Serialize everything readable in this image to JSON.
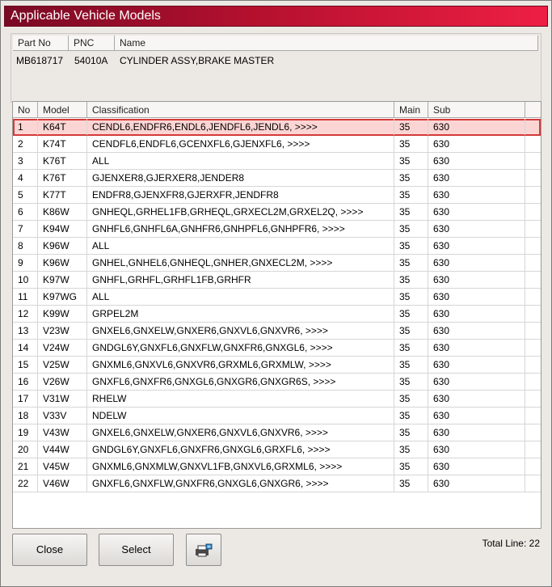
{
  "window": {
    "title": "Applicable Vehicle Models"
  },
  "part": {
    "headers": {
      "part_no": "Part No",
      "pnc": "PNC",
      "name": "Name"
    },
    "values": {
      "part_no": "MB618717",
      "pnc": "54010A",
      "name": "CYLINDER ASSY,BRAKE MASTER"
    }
  },
  "table": {
    "headers": {
      "no": "No",
      "model": "Model",
      "classification": "Classification",
      "main": "Main",
      "sub": "Sub"
    },
    "selected_index": 0,
    "rows": [
      {
        "no": "1",
        "model": "K64T",
        "classification": "CENDL6,ENDFR6,ENDL6,JENDFL6,JENDL6,  >>>>",
        "main": "35",
        "sub": "630"
      },
      {
        "no": "2",
        "model": "K74T",
        "classification": "CENDFL6,ENDFL6,GCENXFL6,GJENXFL6,  >>>>",
        "main": "35",
        "sub": "630"
      },
      {
        "no": "3",
        "model": "K76T",
        "classification": "ALL",
        "main": "35",
        "sub": "630"
      },
      {
        "no": "4",
        "model": "K76T",
        "classification": "GJENXER8,GJERXER8,JENDER8",
        "main": "35",
        "sub": "630"
      },
      {
        "no": "5",
        "model": "K77T",
        "classification": "ENDFR8,GJENXFR8,GJERXFR,JENDFR8",
        "main": "35",
        "sub": "630"
      },
      {
        "no": "6",
        "model": "K86W",
        "classification": "GNHEQL,GRHEL1FB,GRHEQL,GRXECL2M,GRXEL2Q,  >>>>",
        "main": "35",
        "sub": "630"
      },
      {
        "no": "7",
        "model": "K94W",
        "classification": "GNHFL6,GNHFL6A,GNHFR6,GNHPFL6,GNHPFR6,  >>>>",
        "main": "35",
        "sub": "630"
      },
      {
        "no": "8",
        "model": "K96W",
        "classification": "ALL",
        "main": "35",
        "sub": "630"
      },
      {
        "no": "9",
        "model": "K96W",
        "classification": "GNHEL,GNHEL6,GNHEQL,GNHER,GNXECL2M,  >>>>",
        "main": "35",
        "sub": "630"
      },
      {
        "no": "10",
        "model": "K97W",
        "classification": "GNHFL,GRHFL,GRHFL1FB,GRHFR",
        "main": "35",
        "sub": "630"
      },
      {
        "no": "11",
        "model": "K97WG",
        "classification": "ALL",
        "main": "35",
        "sub": "630"
      },
      {
        "no": "12",
        "model": "K99W",
        "classification": "GRPEL2M",
        "main": "35",
        "sub": "630"
      },
      {
        "no": "13",
        "model": "V23W",
        "classification": "GNXEL6,GNXELW,GNXER6,GNXVL6,GNXVR6,  >>>>",
        "main": "35",
        "sub": "630"
      },
      {
        "no": "14",
        "model": "V24W",
        "classification": "GNDGL6Y,GNXFL6,GNXFLW,GNXFR6,GNXGL6,  >>>>",
        "main": "35",
        "sub": "630"
      },
      {
        "no": "15",
        "model": "V25W",
        "classification": "GNXML6,GNXVL6,GNXVR6,GRXML6,GRXMLW,  >>>>",
        "main": "35",
        "sub": "630"
      },
      {
        "no": "16",
        "model": "V26W",
        "classification": "GNXFL6,GNXFR6,GNXGL6,GNXGR6,GNXGR6S,  >>>>",
        "main": "35",
        "sub": "630"
      },
      {
        "no": "17",
        "model": "V31W",
        "classification": "RHELW",
        "main": "35",
        "sub": "630"
      },
      {
        "no": "18",
        "model": "V33V",
        "classification": "NDELW",
        "main": "35",
        "sub": "630"
      },
      {
        "no": "19",
        "model": "V43W",
        "classification": "GNXEL6,GNXELW,GNXER6,GNXVL6,GNXVR6,  >>>>",
        "main": "35",
        "sub": "630"
      },
      {
        "no": "20",
        "model": "V44W",
        "classification": "GNDGL6Y,GNXFL6,GNXFR6,GNXGL6,GRXFL6,  >>>>",
        "main": "35",
        "sub": "630"
      },
      {
        "no": "21",
        "model": "V45W",
        "classification": "GNXML6,GNXMLW,GNXVL1FB,GNXVL6,GRXML6,  >>>>",
        "main": "35",
        "sub": "630"
      },
      {
        "no": "22",
        "model": "V46W",
        "classification": "GNXFL6,GNXFLW,GNXFR6,GNXGL6,GNXGR6,  >>>>",
        "main": "35",
        "sub": "630"
      }
    ]
  },
  "footer": {
    "close_label": "Close",
    "select_label": "Select",
    "print_icon": "printer-icon",
    "total_line": "Total Line: 22"
  },
  "colors": {
    "title_gradient_start": "#7a0a24",
    "title_gradient_end": "#ee1f44",
    "selected_row": "#fbd5d3",
    "selected_border": "#d43a3a"
  }
}
